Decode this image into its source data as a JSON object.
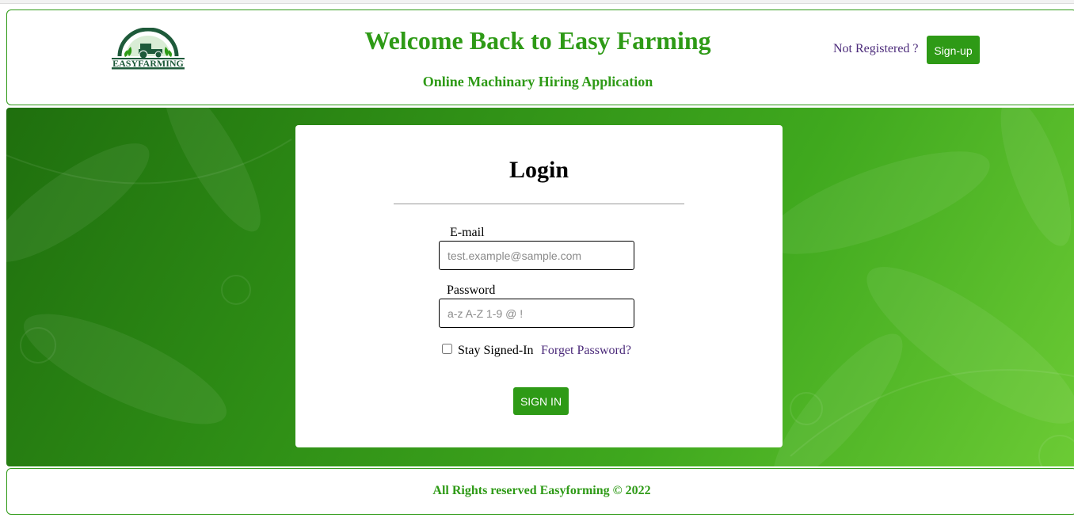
{
  "header": {
    "logo_text": "EASYFARMING",
    "title": "Welcome Back to Easy Farming",
    "subtitle": "Online Machinary Hiring Application",
    "not_registered": "Not Registered ?",
    "signup_label": "Sign-up"
  },
  "login": {
    "title": "Login",
    "email_label": "E-mail",
    "email_placeholder": "test.example@sample.com",
    "email_value": "",
    "password_label": "Password",
    "password_placeholder": "a-z A-Z 1-9 @ !",
    "password_value": "",
    "stay_signed_in_label": "Stay Signed-In",
    "stay_signed_in_checked": false,
    "forget_password_label": "Forget Password?",
    "signin_label": "SIGN IN"
  },
  "footer": {
    "text": "All Rights reserved Easyforming © 2022"
  },
  "colors": {
    "brand_green": "#2e9a16",
    "link_purple": "#4b2a7a",
    "logo_dark_green": "#1e5a3a"
  },
  "icons": {
    "logo": "tractor-logo-icon"
  }
}
